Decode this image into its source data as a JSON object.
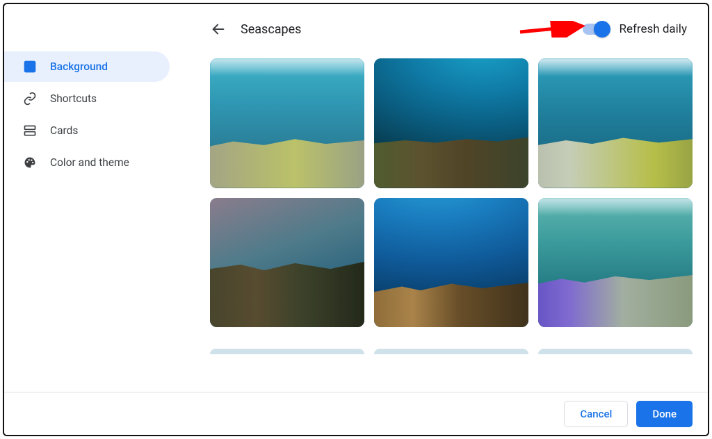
{
  "header": {
    "title": "Seascapes",
    "refresh_label": "Refresh daily",
    "refresh_enabled": true
  },
  "sidebar": {
    "items": [
      {
        "key": "background",
        "label": "Background",
        "active": true,
        "icon": "image-icon"
      },
      {
        "key": "shortcuts",
        "label": "Shortcuts",
        "active": false,
        "icon": "link-icon"
      },
      {
        "key": "cards",
        "label": "Cards",
        "active": false,
        "icon": "cards-icon"
      },
      {
        "key": "color",
        "label": "Color and theme",
        "active": false,
        "icon": "palette-icon"
      }
    ]
  },
  "grid": {
    "items": [
      {
        "id": "sea-1",
        "alt": "Underwater coral reef, bright turquoise"
      },
      {
        "id": "sea-2",
        "alt": "Deep blue underwater with coral bed"
      },
      {
        "id": "sea-3",
        "alt": "Near-surface reef with white and yellow coral"
      },
      {
        "id": "sea-4",
        "alt": "Hazy reef with mixed coral"
      },
      {
        "id": "sea-5",
        "alt": "Sunlit blue water with orange coral"
      },
      {
        "id": "sea-6",
        "alt": "Teal water with purple coral"
      }
    ]
  },
  "footer": {
    "cancel": "Cancel",
    "done": "Done"
  },
  "annotation": {
    "arrow_points_to": "refresh-daily-toggle",
    "arrow_color": "#ff0000"
  },
  "colors": {
    "accent": "#1a73e8",
    "accent_light": "#e8f0fe"
  }
}
